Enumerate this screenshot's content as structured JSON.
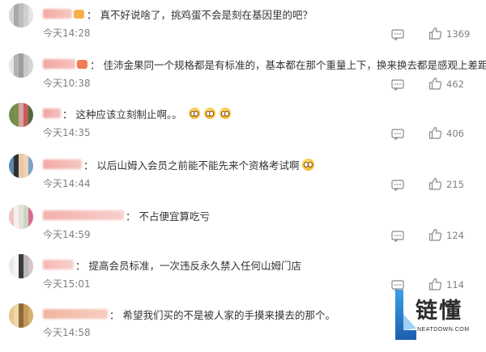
{
  "comments": [
    {
      "nickname": "A...",
      "text": "真不好说啥了，挑鸡蛋不会是刻在基因里的吧？",
      "emojis": 0,
      "time": "今天14:28",
      "likes": "1369"
    },
    {
      "nickname": "S...",
      "text": "佳沛金果同一个规格都是有标准的，基本都在那个重量上下，换来换去都是感观上差距",
      "emojis": 1,
      "time": "今天10:38",
      "likes": "462"
    },
    {
      "nickname": "R...",
      "text": "这种应该立刻制止啊。。",
      "emojis": 3,
      "time": "今天14:35",
      "likes": "406"
    },
    {
      "nickname": "B...",
      "text": "以后山姆入会员之前能不能先来个资格考试啊",
      "emojis": 1,
      "time": "今天14:44",
      "likes": "215"
    },
    {
      "nickname": "M...",
      "text": "不占便宜算吃亏",
      "emojis": 0,
      "time": "今天14:59",
      "likes": "124"
    },
    {
      "nickname": "C...",
      "text": "提高会员标准，一次违反永久禁入任何山姆门店",
      "emojis": 0,
      "time": "今天15:01",
      "likes": "114"
    },
    {
      "nickname": "W...",
      "text": "希望我们买的不是被人家的手摸来摸去的那个。",
      "emojis": 0,
      "time": "今天14:58",
      "likes": ""
    }
  ],
  "logo": {
    "title": "链懂",
    "subtitle": "NEATDOWN.COM"
  }
}
